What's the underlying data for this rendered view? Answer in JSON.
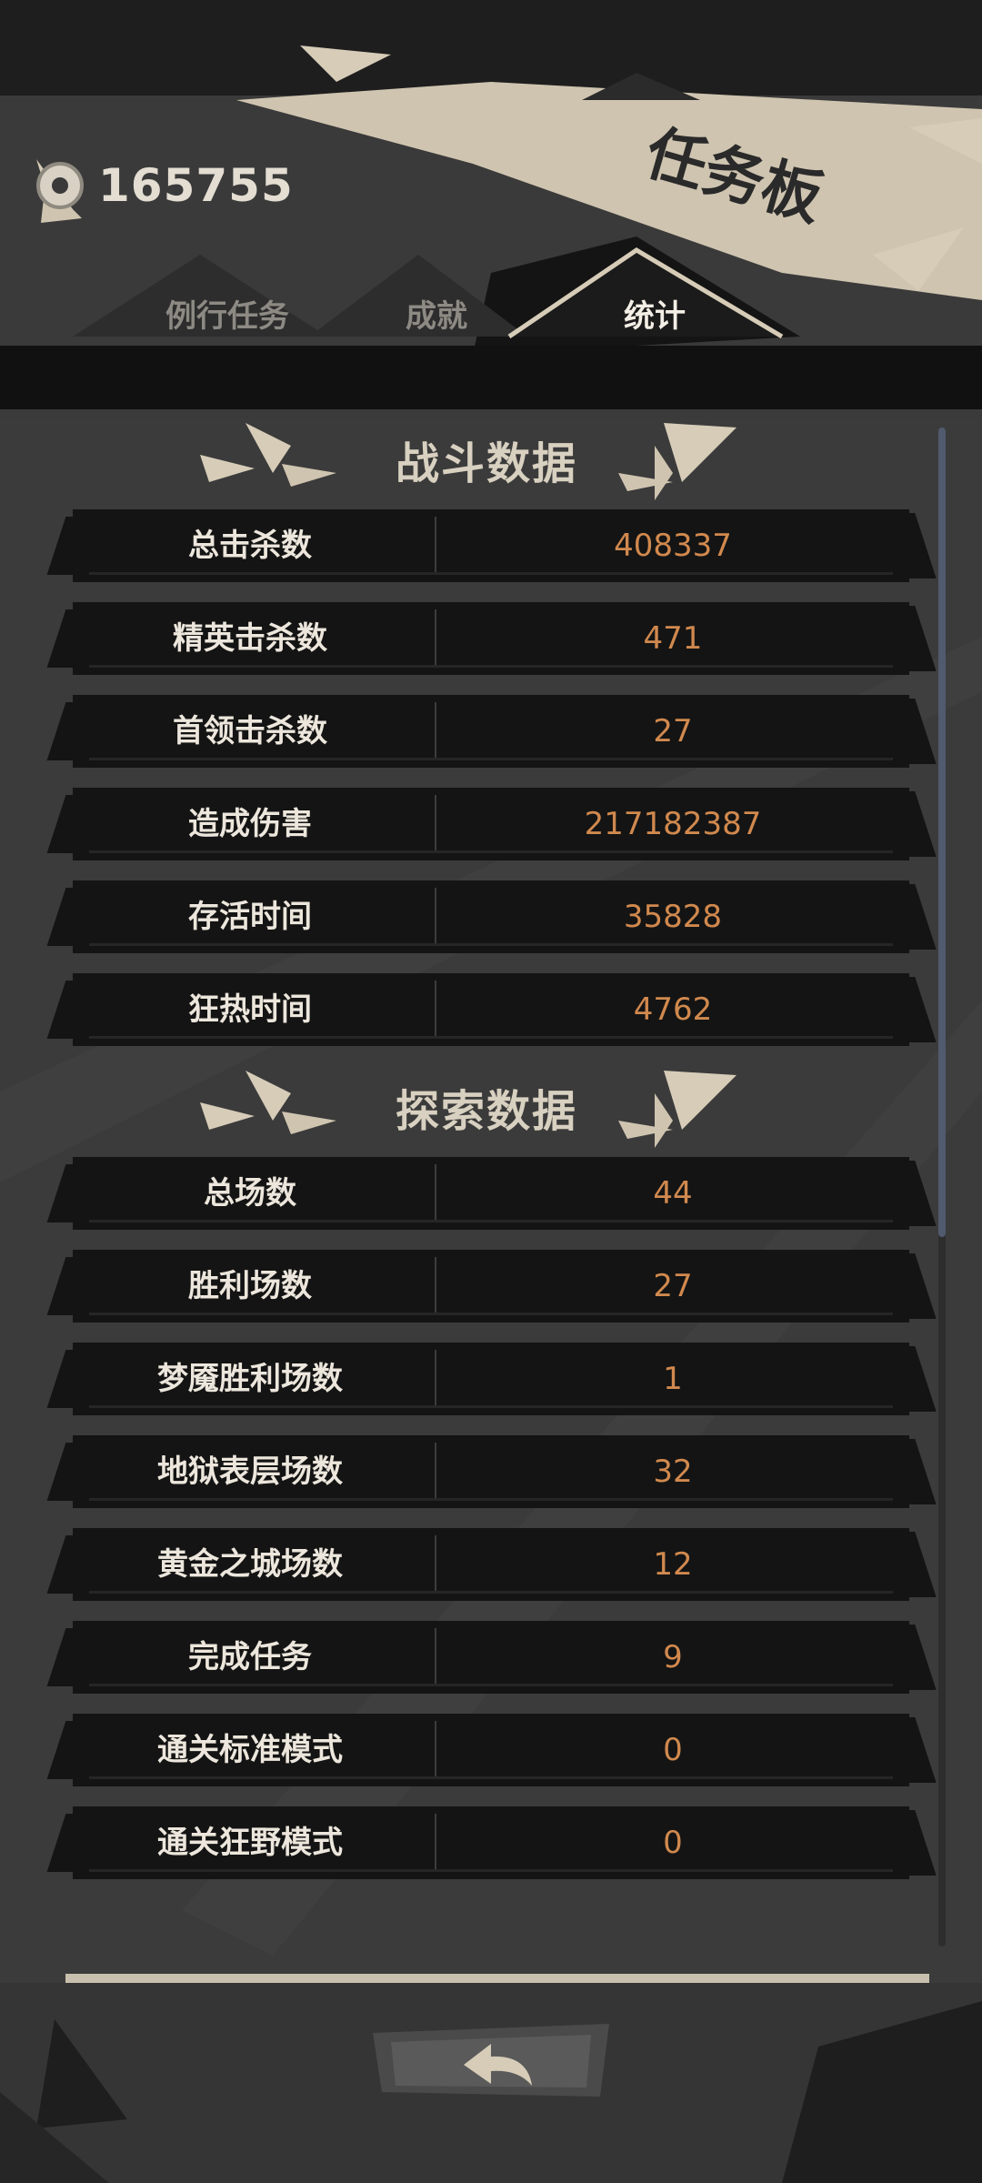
{
  "header": {
    "coin_icon": "coin-eye-icon",
    "coins": "165755",
    "title": "任务板"
  },
  "tabs": [
    {
      "label": "例行任务",
      "active": false
    },
    {
      "label": "成就",
      "active": false
    },
    {
      "label": "统计",
      "active": true
    }
  ],
  "sections": [
    {
      "title": "战斗数据",
      "rows": [
        {
          "label": "总击杀数",
          "value": "408337"
        },
        {
          "label": "精英击杀数",
          "value": "471"
        },
        {
          "label": "首领击杀数",
          "value": "27"
        },
        {
          "label": "造成伤害",
          "value": "217182387"
        },
        {
          "label": "存活时间",
          "value": "35828"
        },
        {
          "label": "狂热时间",
          "value": "4762"
        }
      ]
    },
    {
      "title": "探索数据",
      "rows": [
        {
          "label": "总场数",
          "value": "44"
        },
        {
          "label": "胜利场数",
          "value": "27"
        },
        {
          "label": "梦魇胜利场数",
          "value": "1"
        },
        {
          "label": "地狱表层场数",
          "value": "32"
        },
        {
          "label": "黄金之城场数",
          "value": "12"
        },
        {
          "label": "完成任务",
          "value": "9"
        },
        {
          "label": "通关标准模式",
          "value": "0"
        },
        {
          "label": "通关狂野模式",
          "value": "0"
        }
      ]
    }
  ],
  "footer": {
    "back_icon": "back-arrow-icon"
  },
  "colors": {
    "value": "#d1894e",
    "label": "#ece6dc",
    "accent": "#d8d0c0"
  }
}
